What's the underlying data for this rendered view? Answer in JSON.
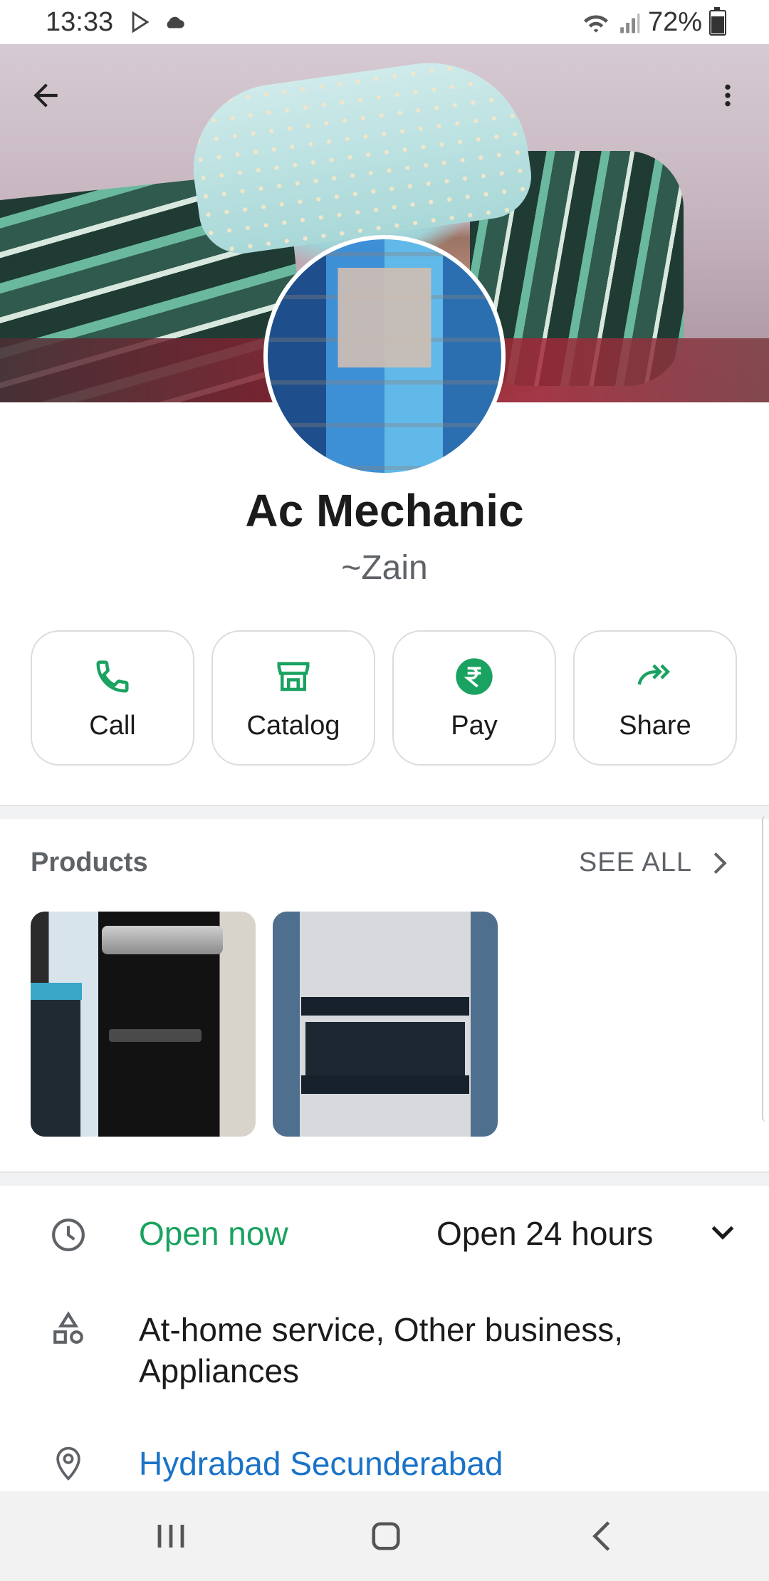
{
  "status_bar": {
    "time": "13:33",
    "battery": "72%",
    "battery_level": 0.72
  },
  "header": {
    "business_name": "Ac Mechanic",
    "owner_name": "~Zain"
  },
  "actions": [
    {
      "label": "Call",
      "icon": "phone-icon"
    },
    {
      "label": "Catalog",
      "icon": "storefront-icon"
    },
    {
      "label": "Pay",
      "icon": "rupee-icon"
    },
    {
      "label": "Share",
      "icon": "forward-icon"
    }
  ],
  "products": {
    "title": "Products",
    "see_all": "SEE ALL"
  },
  "info": {
    "hours_status": "Open now",
    "hours_detail": "Open 24 hours",
    "categories": "At-home service, Other business, Appliances",
    "location": "Hydrabad Secunderabad"
  },
  "colors": {
    "accent_green": "#1aa260",
    "link_blue": "#1a73c8",
    "text_primary": "#1b1b1b",
    "text_secondary": "#5f6368"
  }
}
